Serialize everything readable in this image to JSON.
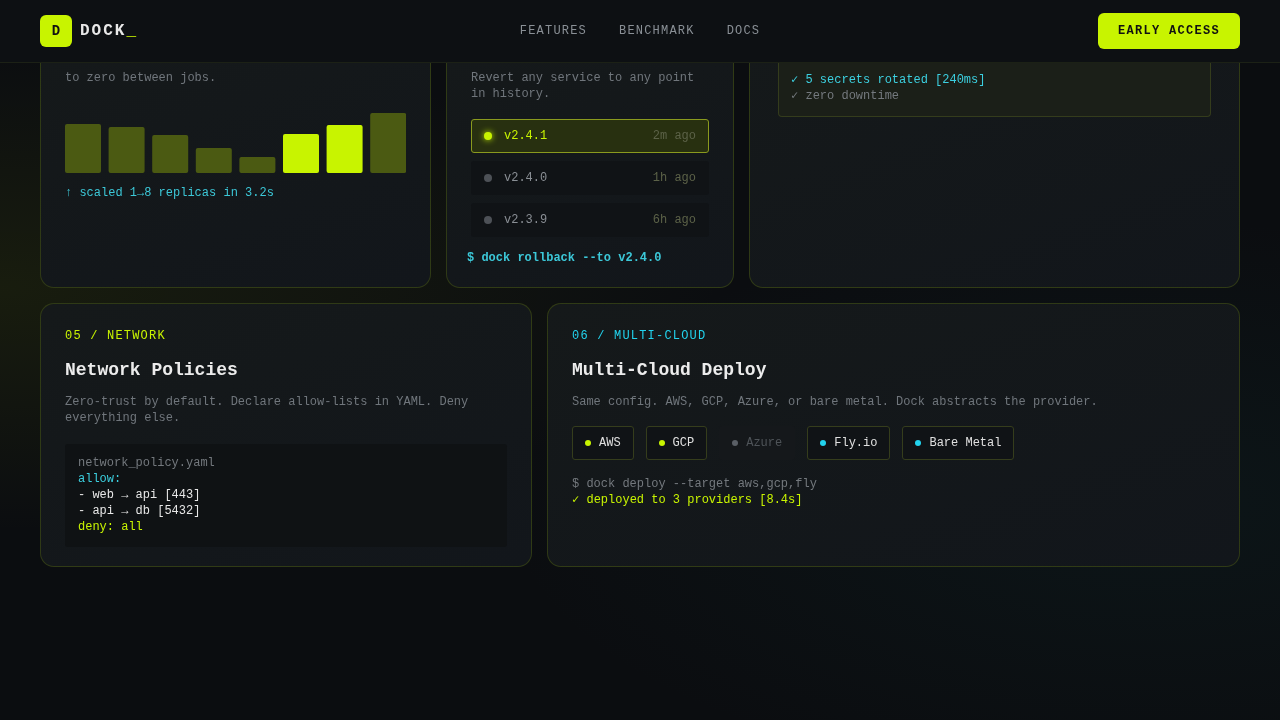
{
  "header": {
    "logo_mark": "D",
    "logo_text": "DOCK",
    "logo_cursor": "_",
    "nav": [
      "FEATURES",
      "BENCHMARK",
      "DOCS"
    ],
    "cta": "EARLY ACCESS"
  },
  "scaling_card": {
    "description": "to zero between jobs.",
    "caption": "↑ scaled 1→8 replicas in 3.2s"
  },
  "rollback_card": {
    "description": "Revert any service to any point in history.",
    "versions": [
      {
        "version": "v2.4.1",
        "age": "2m ago",
        "selected": true
      },
      {
        "version": "v2.4.0",
        "age": "1h ago",
        "selected": false
      },
      {
        "version": "v2.3.9",
        "age": "6h ago",
        "selected": false
      }
    ],
    "command": "$ dock rollback --to v2.4.0"
  },
  "secrets_card": {
    "terminal": [
      {
        "kind": "info",
        "text": "✓ 5 secrets rotated [240ms]"
      },
      {
        "kind": "muted",
        "text": "✓ zero downtime"
      }
    ]
  },
  "network_card": {
    "tag": "05 / NETWORK",
    "title": "Network Policies",
    "description": "Zero-trust by default. Declare allow-lists in YAML. Deny everything else.",
    "code": [
      {
        "kind": "muted",
        "text": "network_policy.yaml"
      },
      {
        "kind": "info",
        "text": "allow:"
      },
      {
        "kind": "plain",
        "text": "- web → api [443]"
      },
      {
        "kind": "plain",
        "text": "- api → db [5432]"
      },
      {
        "kind": "accent",
        "text": "deny: all"
      }
    ]
  },
  "cloud_card": {
    "tag": "06 / MULTI-CLOUD",
    "title": "Multi-Cloud Deploy",
    "description": "Same config. AWS, GCP, Azure, or bare metal. Dock abstracts the provider.",
    "providers": [
      {
        "name": "AWS",
        "color": "#c8f400",
        "disabled": false
      },
      {
        "name": "GCP",
        "color": "#c8f400",
        "disabled": false
      },
      {
        "name": "Azure",
        "color": "#5a5f66",
        "disabled": true
      },
      {
        "name": "Fly.io",
        "color": "#22d3ee",
        "disabled": false
      },
      {
        "name": "Bare Metal",
        "color": "#22d3ee",
        "disabled": false
      }
    ],
    "output": [
      {
        "kind": "muted",
        "text": "$ dock deploy --target aws,gcp,fly"
      },
      {
        "kind": "accent",
        "text": "✓ deployed to 3 providers [8.4s]"
      }
    ]
  }
}
